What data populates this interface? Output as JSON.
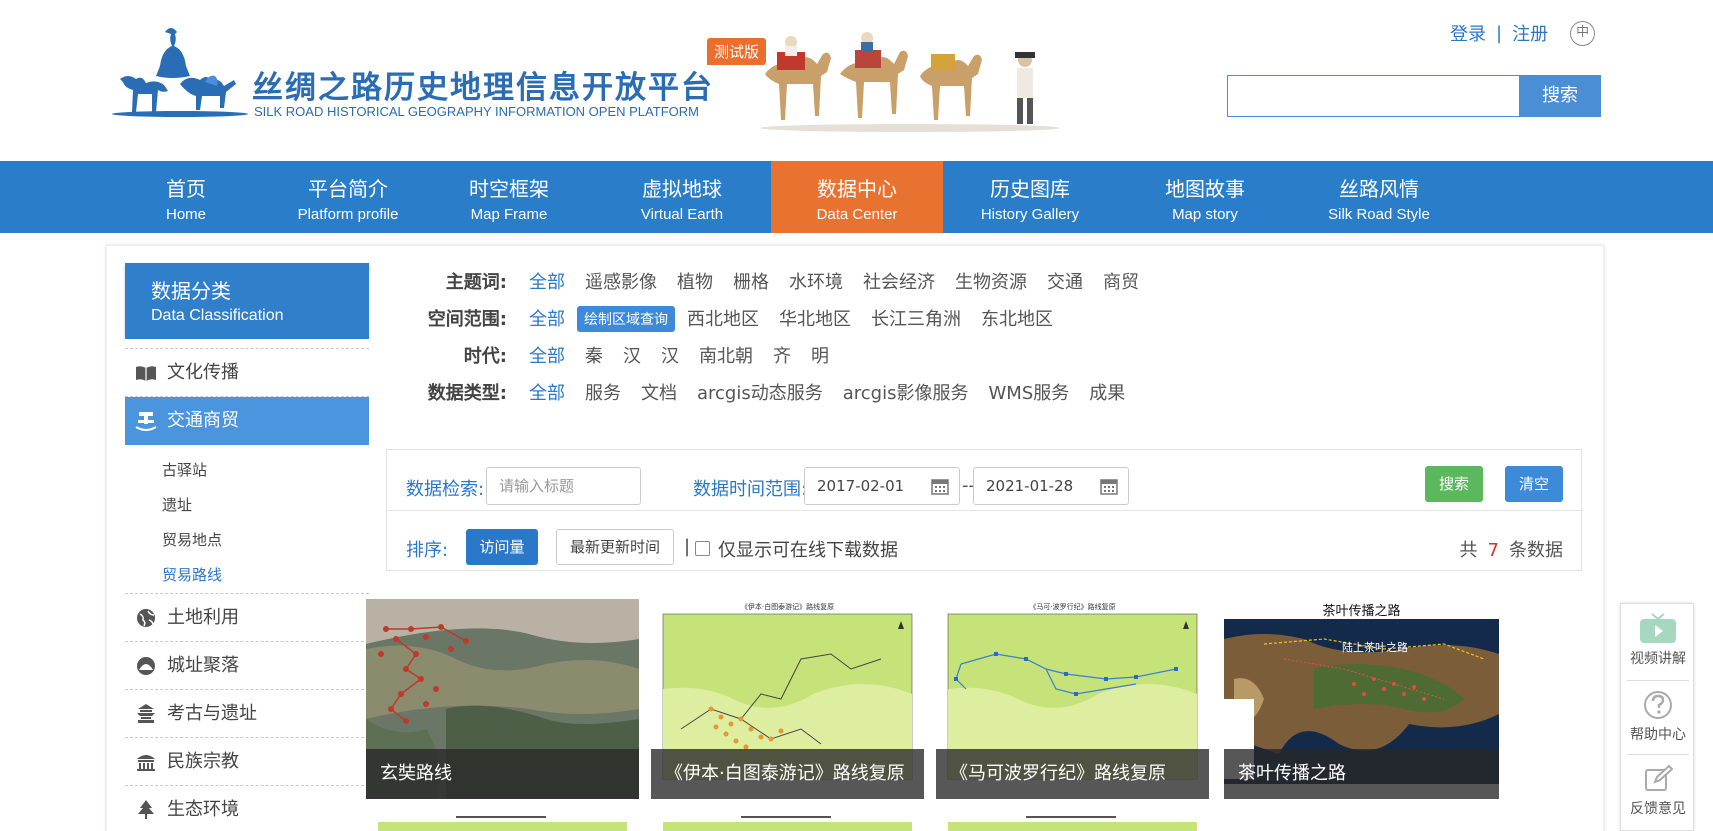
{
  "header": {
    "title": "丝绸之路历史地理信息开放平台",
    "subtitle": "SILK ROAD HISTORICAL GEOGRAPHY INFORMATION OPEN PLATFORM",
    "badge": "测试版",
    "login": "登录",
    "separator": "|",
    "register": "注册",
    "lang": "中",
    "search_button": "搜索",
    "search_value": ""
  },
  "nav": [
    {
      "cn": "首页",
      "en": "Home"
    },
    {
      "cn": "平台简介",
      "en": "Platform profile"
    },
    {
      "cn": "时空框架",
      "en": "Map Frame"
    },
    {
      "cn": "虚拟地球",
      "en": "Virtual Earth"
    },
    {
      "cn": "数据中心",
      "en": "Data Center",
      "active": true
    },
    {
      "cn": "历史图库",
      "en": "History Gallery"
    },
    {
      "cn": "地图故事",
      "en": "Map story"
    },
    {
      "cn": "丝路风情",
      "en": "Silk Road Style"
    }
  ],
  "sidebar": {
    "title_cn": "数据分类",
    "title_en": "Data Classification",
    "items": [
      {
        "label": "文化传播",
        "icon": "book-icon"
      },
      {
        "label": "交通商贸",
        "icon": "trade-icon",
        "active": true
      },
      {
        "label": "土地利用",
        "icon": "globe-icon"
      },
      {
        "label": "城址聚落",
        "icon": "settlement-icon"
      },
      {
        "label": "考古与遗址",
        "icon": "pagoda-icon"
      },
      {
        "label": "民族宗教",
        "icon": "temple-icon"
      },
      {
        "label": "生态环境",
        "icon": "tree-icon"
      }
    ],
    "sub_items": [
      {
        "label": "古驿站"
      },
      {
        "label": "遗址"
      },
      {
        "label": "贸易地点"
      },
      {
        "label": "贸易路线",
        "active": true
      }
    ]
  },
  "filters": {
    "topic": {
      "label": "主题词:",
      "options": [
        "全部",
        "遥感影像",
        "植物",
        "栅格",
        "水环境",
        "社会经济",
        "生物资源",
        "交通",
        "商贸"
      ]
    },
    "space": {
      "label": "空间范围:",
      "all": "全部",
      "draw": "绘制区域查询",
      "options": [
        "西北地区",
        "华北地区",
        "长江三角洲",
        "东北地区"
      ]
    },
    "era": {
      "label": "时代:",
      "options": [
        "全部",
        "秦",
        "汉",
        "汉",
        "南北朝",
        "齐",
        "明"
      ]
    },
    "dtype": {
      "label": "数据类型:",
      "options": [
        "全部",
        "服务",
        "文档",
        "arcgis动态服务",
        "arcgis影像服务",
        "WMS服务",
        "成果"
      ]
    }
  },
  "search": {
    "label": "数据检索:",
    "placeholder": "请输入标题",
    "range_label": "数据时间范围:",
    "date_from": "2017-02-01",
    "dash": "--",
    "date_to": "2021-01-28",
    "search_btn": "搜索",
    "clear_btn": "清空",
    "sort_label": "排序:",
    "sort_visits": "访问量",
    "sort_updated": "最新更新时间",
    "bar": "|",
    "download_only": "仅显示可在线下载数据",
    "total_prefix": "共",
    "total_count": "7",
    "total_suffix": "条数据"
  },
  "cards": [
    {
      "title": "玄奘路线"
    },
    {
      "title": "《伊本·白图泰游记》路线复原",
      "map_title": "《伊本·白图泰游记》路线复原"
    },
    {
      "title": "《马可波罗行纪》路线复原",
      "map_title": "《马可·波罗行纪》路线复原"
    },
    {
      "title": "茶叶传播之路",
      "map_title": "茶叶传播之路",
      "inner_label": "陆上茶叶之路"
    }
  ],
  "widget": {
    "video": "视频讲解",
    "help": "帮助中心",
    "feedback": "反馈意见"
  },
  "colors": {
    "primary": "#2a7dc9",
    "accent": "#e8722f",
    "link": "#2a78c8",
    "green": "#5cb85c",
    "count": "#d9312b"
  }
}
